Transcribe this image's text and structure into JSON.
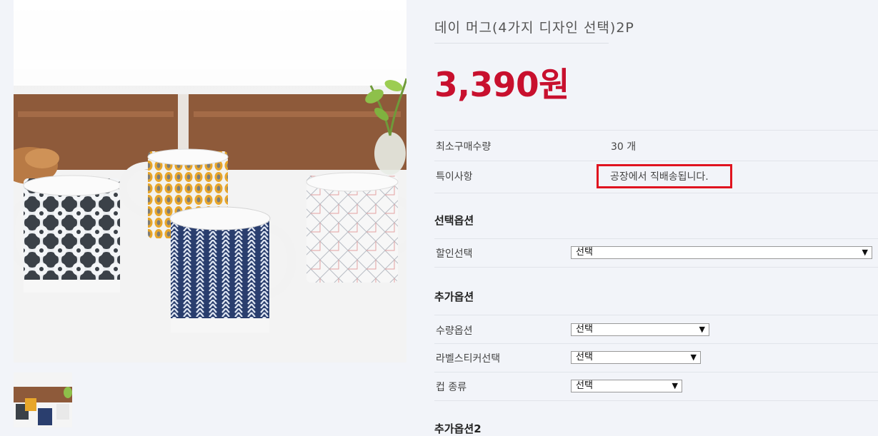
{
  "product": {
    "title": "데이 머그(4가지 디자인 선택)2P",
    "price": "3,390원"
  },
  "info_rows": {
    "min_qty_label": "최소구매수량",
    "min_qty_value": "30 개",
    "note_label": "특이사항",
    "note_value": "공장에서 직배송됩니다."
  },
  "select_options": {
    "title": "선택옵션",
    "discount_label": "할인선택",
    "discount_value": "선택"
  },
  "extra_options": {
    "title": "추가옵션",
    "qty_option_label": "수량옵션",
    "qty_option_value": "선택",
    "label_sticker_label": "라벨스티커선택",
    "label_sticker_value": "선택",
    "cup_type_label": "컵 종류",
    "cup_type_value": "선택"
  },
  "extra_options2": {
    "title_partial": "추가옵션2"
  },
  "icons": {
    "dropdown": "▼"
  },
  "colors": {
    "price": "#c8102e",
    "highlight_box": "#e0131f"
  }
}
